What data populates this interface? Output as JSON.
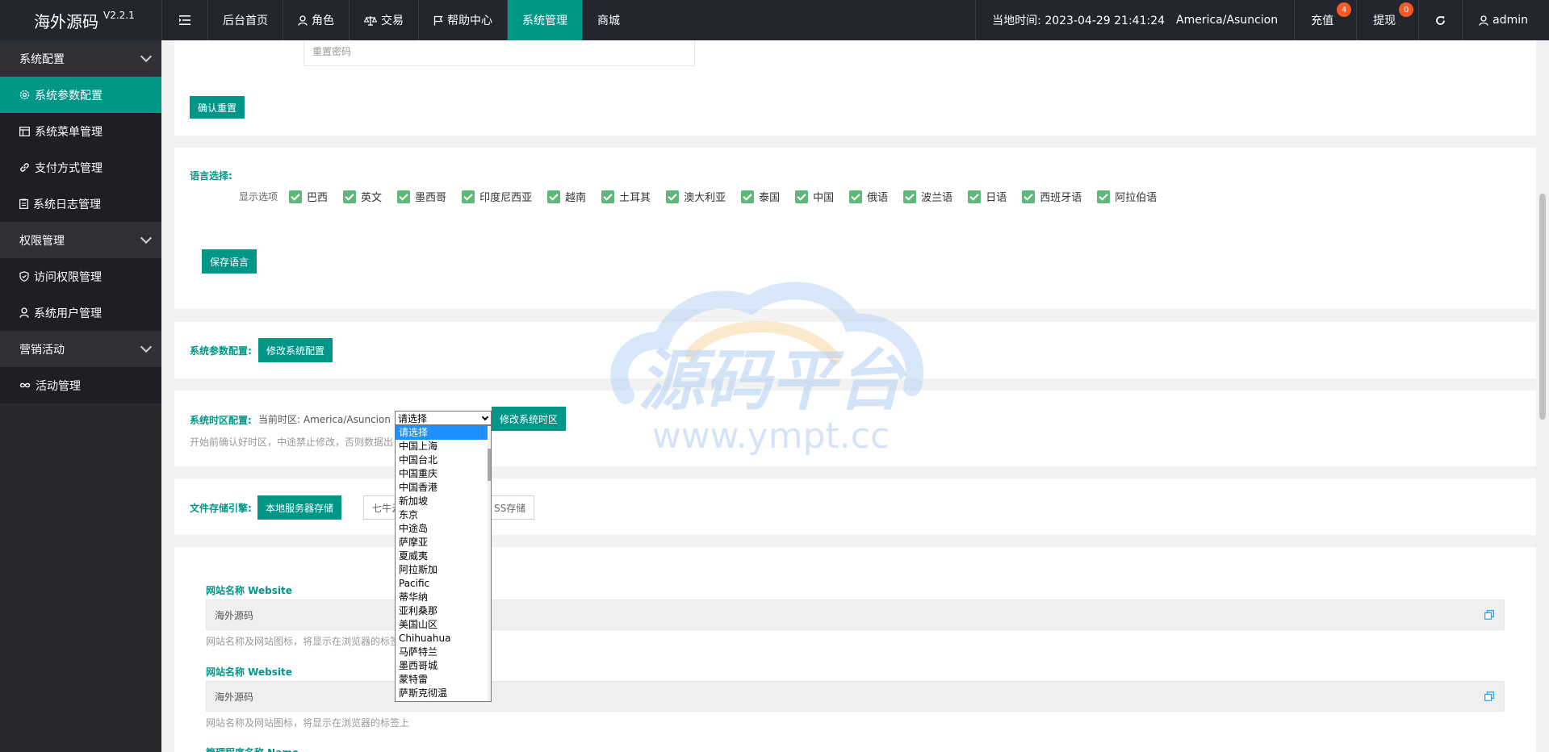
{
  "header": {
    "logo": "海外源码",
    "version": "V2.2.1",
    "nav": [
      {
        "label": "后台首页",
        "icon": ""
      },
      {
        "label": "角色",
        "icon": "user-icon"
      },
      {
        "label": "交易",
        "icon": "scale-icon"
      },
      {
        "label": "帮助中心",
        "icon": "flag-icon"
      },
      {
        "label": "系统管理",
        "icon": ""
      },
      {
        "label": "商城",
        "icon": ""
      }
    ],
    "time_label": "当地时间: 2023-04-29 21:41:24",
    "timezone": "America/Asuncion",
    "recharge": "充值",
    "recharge_badge": "4",
    "withdraw": "提现",
    "withdraw_badge": "0",
    "user": "admin"
  },
  "sidebar": {
    "groups": [
      {
        "label": "系统配置",
        "items": [
          "系统参数配置",
          "系统菜单管理",
          "支付方式管理",
          "系统日志管理"
        ]
      },
      {
        "label": "权限管理",
        "items": [
          "访问权限管理",
          "系统用户管理"
        ]
      },
      {
        "label": "营销活动",
        "items": [
          "活动管理"
        ]
      }
    ]
  },
  "reset": {
    "placeholder": "重置密码",
    "button": "确认重置"
  },
  "language": {
    "title": "语言选择:",
    "lead": "显示选项",
    "options": [
      "巴西",
      "英文",
      "墨西哥",
      "印度尼西亚",
      "越南",
      "土耳其",
      "澳大利亚",
      "泰国",
      "中国",
      "俄语",
      "波兰语",
      "日语",
      "西班牙语",
      "阿拉伯语"
    ],
    "save": "保存语言"
  },
  "sysparams": {
    "title": "系统参数配置:",
    "button": "修改系统配置"
  },
  "timezone_cfg": {
    "title": "系统时区配置:",
    "current": "当前时区: America/Asuncion",
    "select_value": "请选择",
    "button": "修改系统时区",
    "hint": "开始前确认好时区，中途禁止修改，否则数据出",
    "options": [
      "请选择",
      "中国上海",
      "中国台北",
      "中国重庆",
      "中国香港",
      "新加坡",
      "东京",
      "中途岛",
      "萨摩亚",
      "夏威夷",
      "阿拉斯加",
      "Pacific",
      "蒂华纳",
      "亚利桑那",
      "美国山区",
      "Chihuahua",
      "马萨特兰",
      "墨西哥城",
      "蒙特雷",
      "萨斯克彻温"
    ]
  },
  "storage": {
    "title": "文件存储引擎:",
    "local": "本地服务器存储",
    "qiniu": "七牛云对",
    "oss": "SS存储"
  },
  "fields": [
    {
      "title": "网站名称 Website",
      "value": "海外源码",
      "hint": "网站名称及网站图标，将显示在浏览器的标签上"
    },
    {
      "title": "网站名称 Website",
      "value": "海外源码",
      "hint": "网站名称及网站图标，将显示在浏览器的标签上"
    }
  ],
  "field_partial_title": "管理程序名称 Name",
  "watermark": {
    "text": "源码平台",
    "url": "www.ympt.cc"
  }
}
